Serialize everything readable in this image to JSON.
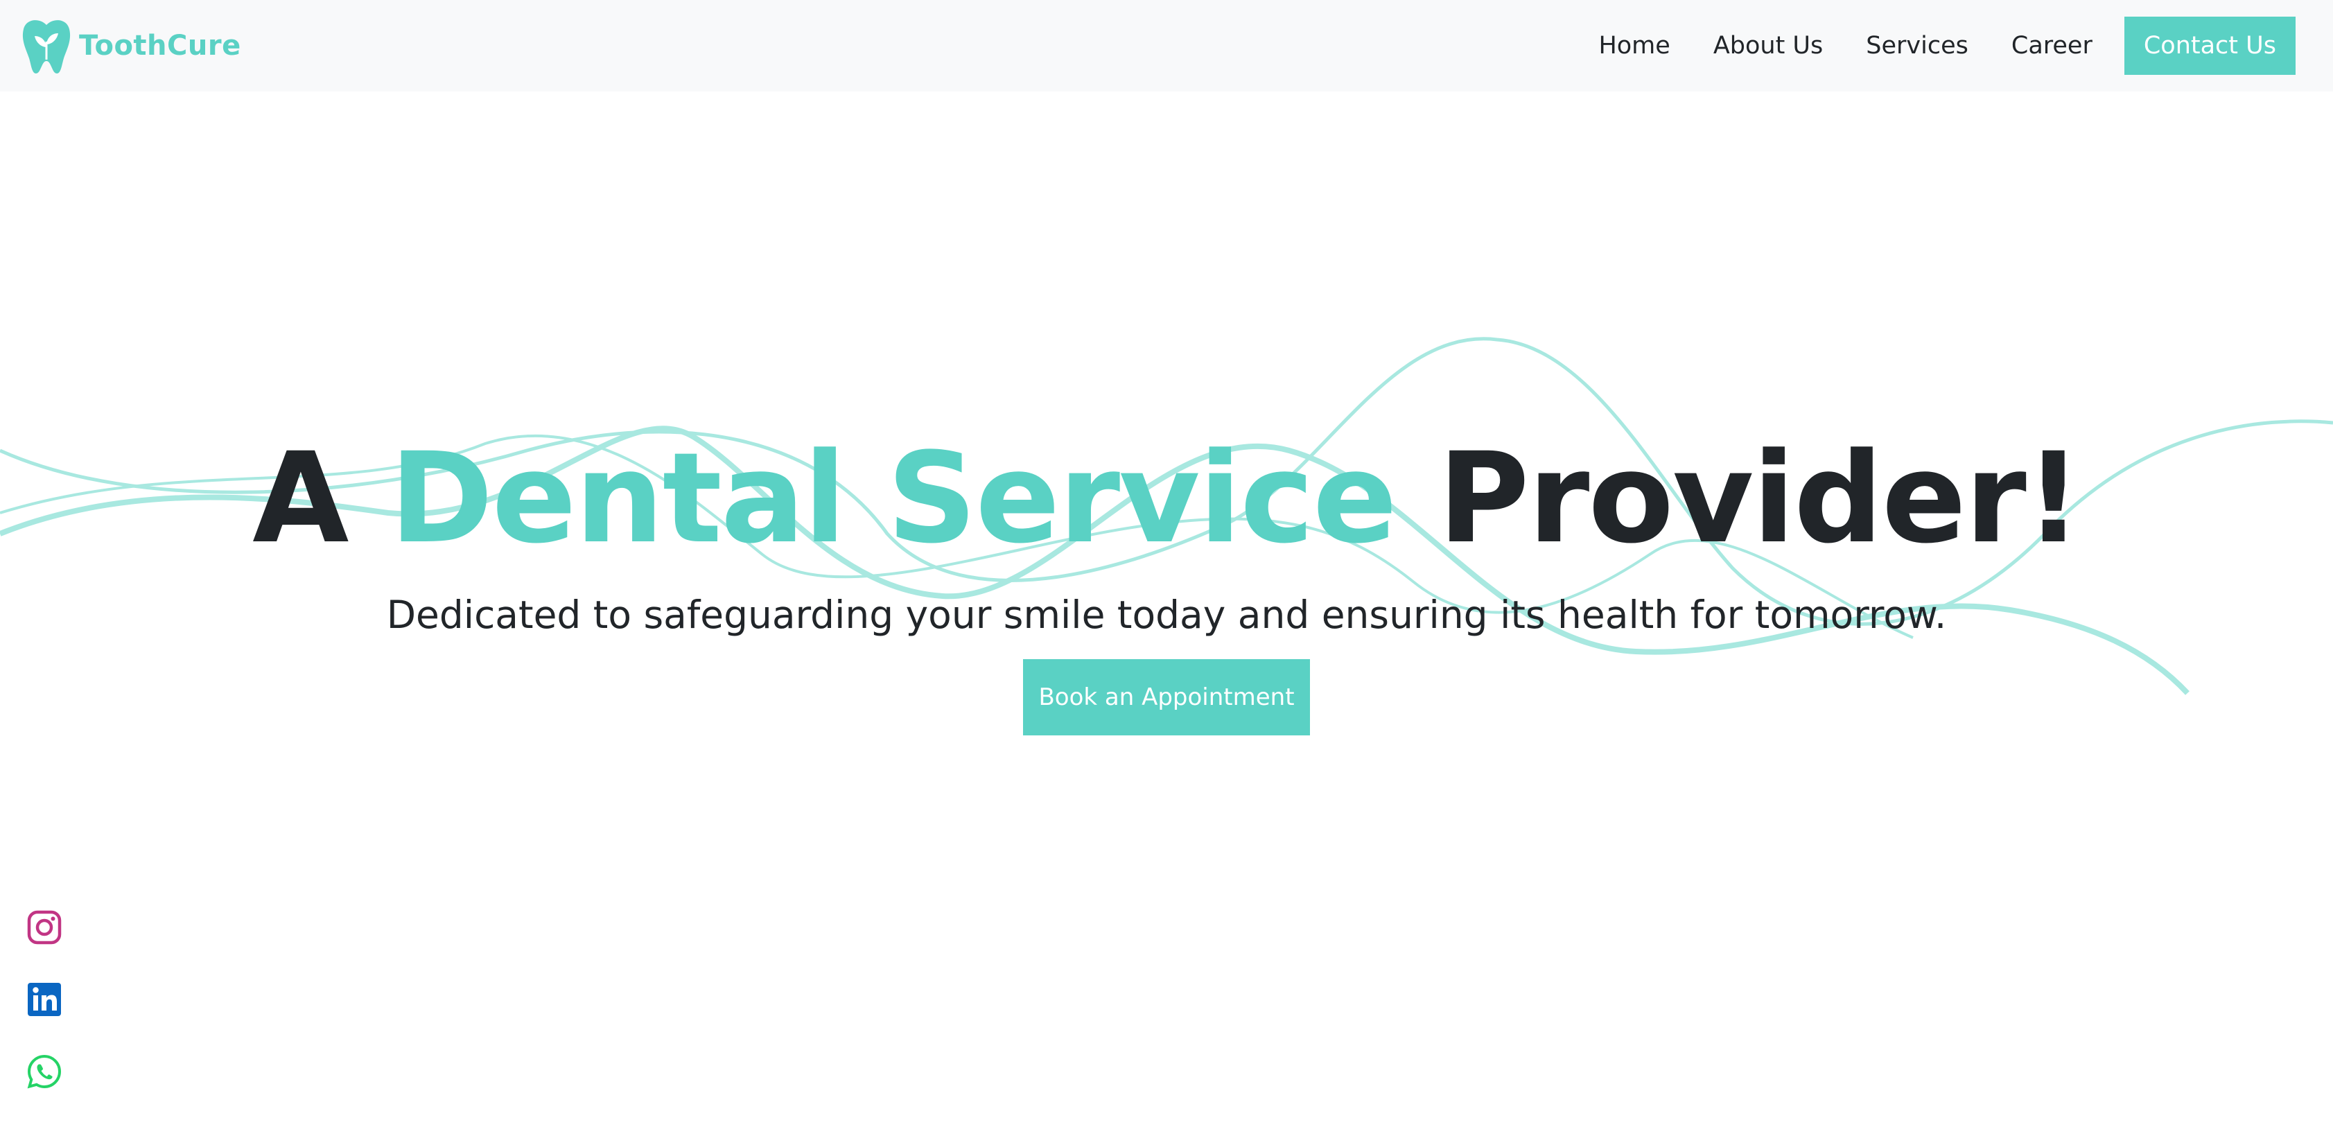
{
  "brand": {
    "name": "ToothCure",
    "logo_icon": "tooth-leaf-icon",
    "color": "#5ad1c4"
  },
  "nav": {
    "links": [
      "Home",
      "About Us",
      "Services",
      "Career"
    ],
    "cta": "Contact Us"
  },
  "hero": {
    "title_before": "A ",
    "title_accent": "Dental Service",
    "title_after": " Provider!",
    "subtitle": "Dedicated to safeguarding your smile today and ensuring its health for tomorrow.",
    "button": "Book an Appointment"
  },
  "socials": [
    {
      "name": "Instagram",
      "icon": "instagram-icon",
      "color": "#c13584"
    },
    {
      "name": "LinkedIn",
      "icon": "linkedin-icon",
      "color": "#0a66c2"
    },
    {
      "name": "WhatsApp",
      "icon": "whatsapp-icon",
      "color": "#25d366"
    }
  ],
  "colors": {
    "accent": "#5ad1c4",
    "wave": "#a8e8e0",
    "text": "#212529",
    "navbar_bg": "#f8f9fa"
  }
}
